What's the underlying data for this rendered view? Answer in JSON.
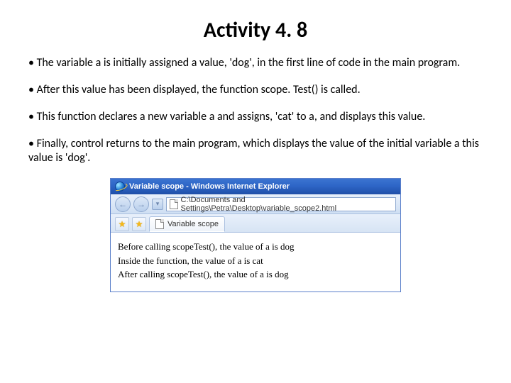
{
  "title": "Activity 4. 8",
  "bullets": {
    "b1": "• The variable a is initially assigned a value, 'dog', in the first line of code in the main program.",
    "b2": "• After this value has been displayed, the function scope. Test() is called.",
    "b3": "• This function declares a new variable a and assigns, 'cat' to a, and displays this value.",
    "b4": "• Finally, control returns to the main program, which displays the value of the initial variable a this value is 'dog'."
  },
  "browser": {
    "window_title": "Variable scope - Windows Internet Explorer",
    "address": "C:\\Documents and Settings\\Petra\\Desktop\\variable_scope2.html",
    "tab_label": "Variable scope",
    "output": {
      "line1": "Before calling scopeTest(), the value of a is dog",
      "line2": "Inside the function, the value of a is cat",
      "line3": "After calling scopeTest(), the value of a is dog"
    }
  }
}
